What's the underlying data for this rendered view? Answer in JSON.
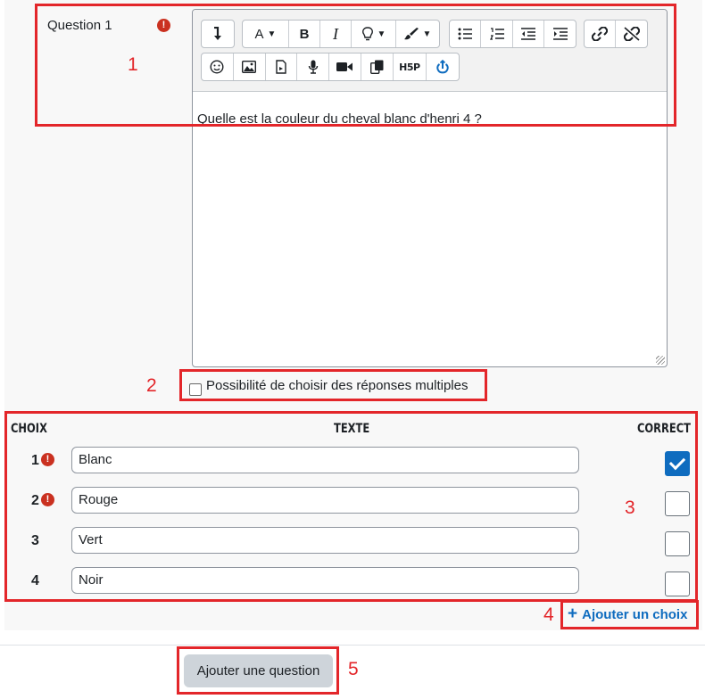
{
  "question": {
    "label": "Question 1",
    "required_icon": "!",
    "text": "Quelle est la couleur du cheval blanc d'henri 4 ?"
  },
  "toolbar": {
    "rows": [
      [
        "collapse",
        "font-color",
        "bold",
        "italic",
        "idea",
        "brush",
        "unordered-list",
        "ordered-list",
        "outdent",
        "indent",
        "link",
        "unlink"
      ],
      [
        "emoji",
        "image",
        "media",
        "microphone",
        "video",
        "copy",
        "h5p",
        "upload"
      ]
    ],
    "h5p_label": "H5P"
  },
  "multiple": {
    "label": "Possibilité de choisir des réponses multiples",
    "checked": false
  },
  "table": {
    "headers": {
      "choice": "CHOIX",
      "text": "TEXTE",
      "correct": "CORRECT"
    },
    "rows": [
      {
        "num": "1",
        "value": "Blanc",
        "correct": true,
        "error": true
      },
      {
        "num": "2",
        "value": "Rouge",
        "correct": false,
        "error": true
      },
      {
        "num": "3",
        "value": "Vert",
        "correct": false,
        "error": false
      },
      {
        "num": "4",
        "value": "Noir",
        "correct": false,
        "error": false
      }
    ]
  },
  "add_choice": {
    "icon": "+",
    "label": "Ajouter un choix"
  },
  "add_question": {
    "label": "Ajouter une question"
  },
  "annotations": [
    "1",
    "2",
    "3",
    "4",
    "5"
  ],
  "colors": {
    "annotation": "#e3262a",
    "error": "#ca3120",
    "link": "#0f6cbf",
    "checkbox_checked": "#0f6cbf",
    "button": "#ced4da"
  }
}
